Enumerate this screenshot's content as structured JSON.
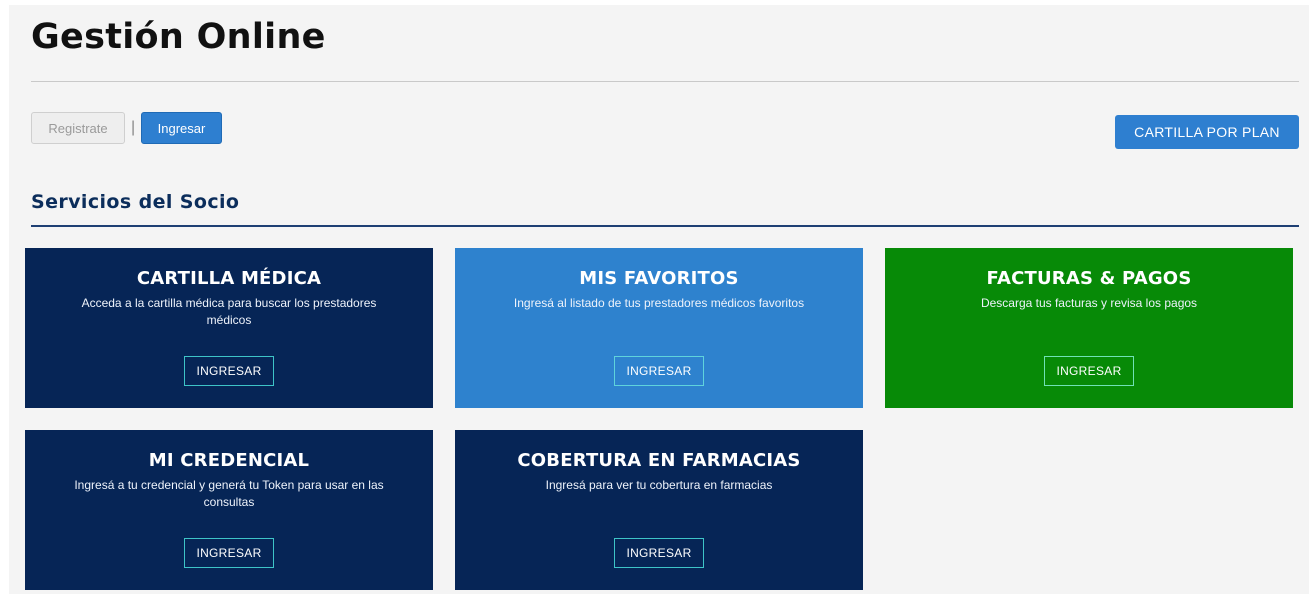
{
  "header": {
    "title": "Gestión Online"
  },
  "auth": {
    "register_label": "Registrate",
    "separator": "|",
    "login_label": "Ingresar"
  },
  "actions": {
    "cartilla_por_plan_label": "CARTILLA POR PLAN"
  },
  "section": {
    "title": "Servicios del Socio"
  },
  "colors": {
    "navy": "#062556",
    "blue": "#2e82ce",
    "green": "#078a07",
    "button_border": "#3ec4c7"
  },
  "cards": [
    {
      "title": "CARTILLA MÉDICA",
      "description": "Acceda a la cartilla médica para buscar los prestadores médicos",
      "button_label": "INGRESAR"
    },
    {
      "title": "MIS FAVORITOS",
      "description": "Ingresá al listado de tus prestadores médicos favoritos",
      "button_label": "INGRESAR"
    },
    {
      "title": "FACTURAS & PAGOS",
      "description": "Descarga tus facturas y revisa los pagos",
      "button_label": "INGRESAR"
    },
    {
      "title": "MI CREDENCIAL",
      "description": "Ingresá a tu credencial y generá tu Token para usar en las consultas",
      "button_label": "INGRESAR"
    },
    {
      "title": "COBERTURA EN FARMACIAS",
      "description": "Ingresá para ver tu cobertura en farmacias",
      "button_label": "INGRESAR"
    }
  ]
}
